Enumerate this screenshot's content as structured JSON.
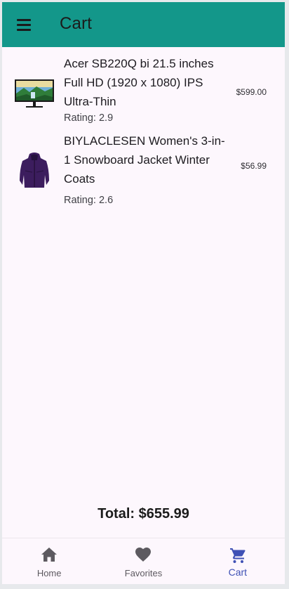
{
  "appbar": {
    "title": "Cart",
    "menu_icon": "menu-icon",
    "background": "#13978a"
  },
  "cart": {
    "items": [
      {
        "name": "Acer SB220Q bi 21.5 inches Full HD (1920 x 1080) IPS Ultra-Thin",
        "rating": "Rating: 2.9",
        "price": "$599.00",
        "image_icon": "monitor-image"
      },
      {
        "name": "BIYLACLESEN Women's 3-in-1 Snowboard Jacket Winter Coats",
        "rating": "Rating: 2.6",
        "price": "$56.99",
        "image_icon": "jacket-image"
      }
    ],
    "total": "Total: $655.99"
  },
  "bottom_nav": {
    "items": [
      {
        "label": "Home",
        "icon": "home-icon",
        "active": false
      },
      {
        "label": "Favorites",
        "icon": "heart-icon",
        "active": false
      },
      {
        "label": "Cart",
        "icon": "cart-icon",
        "active": true
      }
    ],
    "active_color": "#3f51b5",
    "inactive_color": "#5d5a60"
  }
}
